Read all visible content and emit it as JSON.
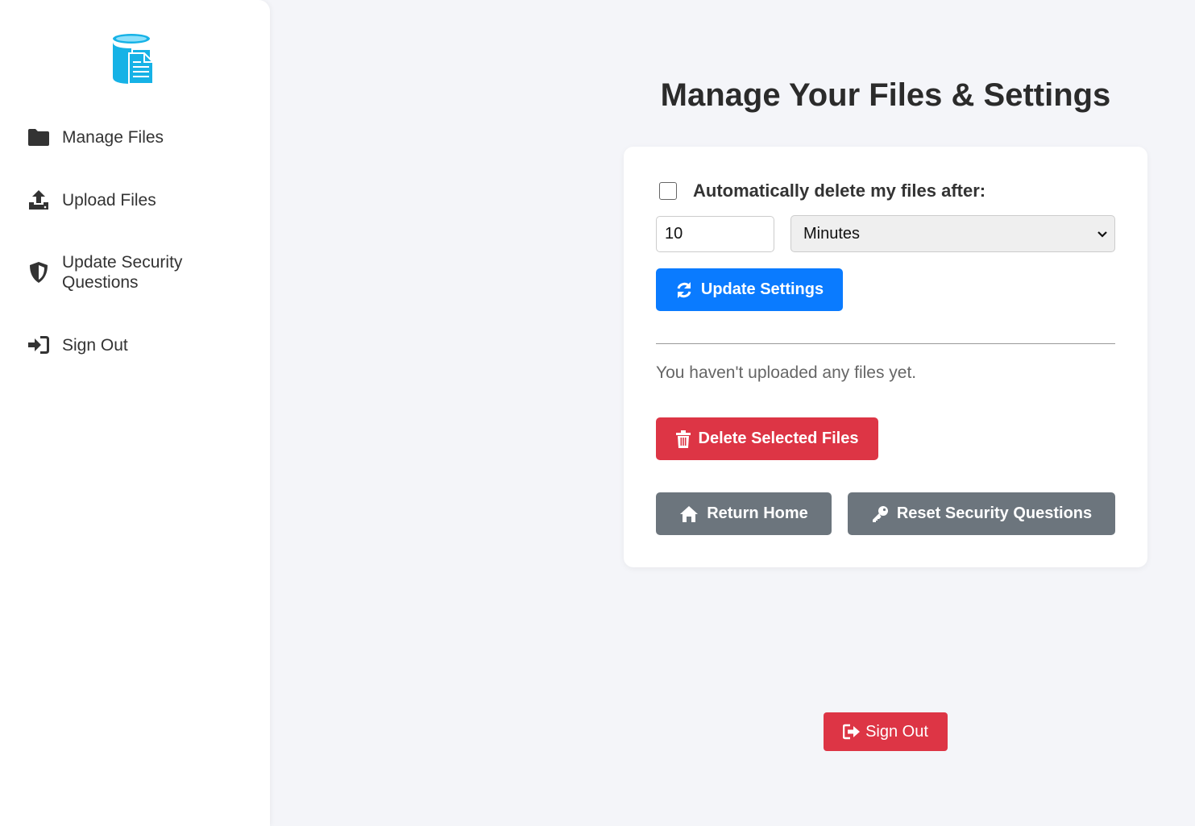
{
  "sidebar": {
    "logo_icon": "database-file-icon",
    "items": [
      {
        "label": "Manage Files",
        "icon": "folder-icon"
      },
      {
        "label": "Upload Files",
        "icon": "upload-icon"
      },
      {
        "label": "Update Security Questions",
        "icon": "shield-icon"
      },
      {
        "label": "Sign Out",
        "icon": "sign-in-icon"
      }
    ]
  },
  "main": {
    "title": "Manage Your Files & Settings",
    "auto_delete": {
      "label": "Automatically delete my files after:",
      "checked": false,
      "amount": "10",
      "unit": "Minutes"
    },
    "update_button": "Update Settings",
    "empty_message": "You haven't uploaded any files yet.",
    "delete_button": "Delete Selected Files",
    "return_home_button": "Return Home",
    "reset_security_button": "Reset Security Questions",
    "sign_out_button": "Sign Out"
  },
  "colors": {
    "primary": "#0a7bff",
    "danger": "#dd3545",
    "secondary": "#6c757d",
    "logo": "#16b2e6"
  }
}
